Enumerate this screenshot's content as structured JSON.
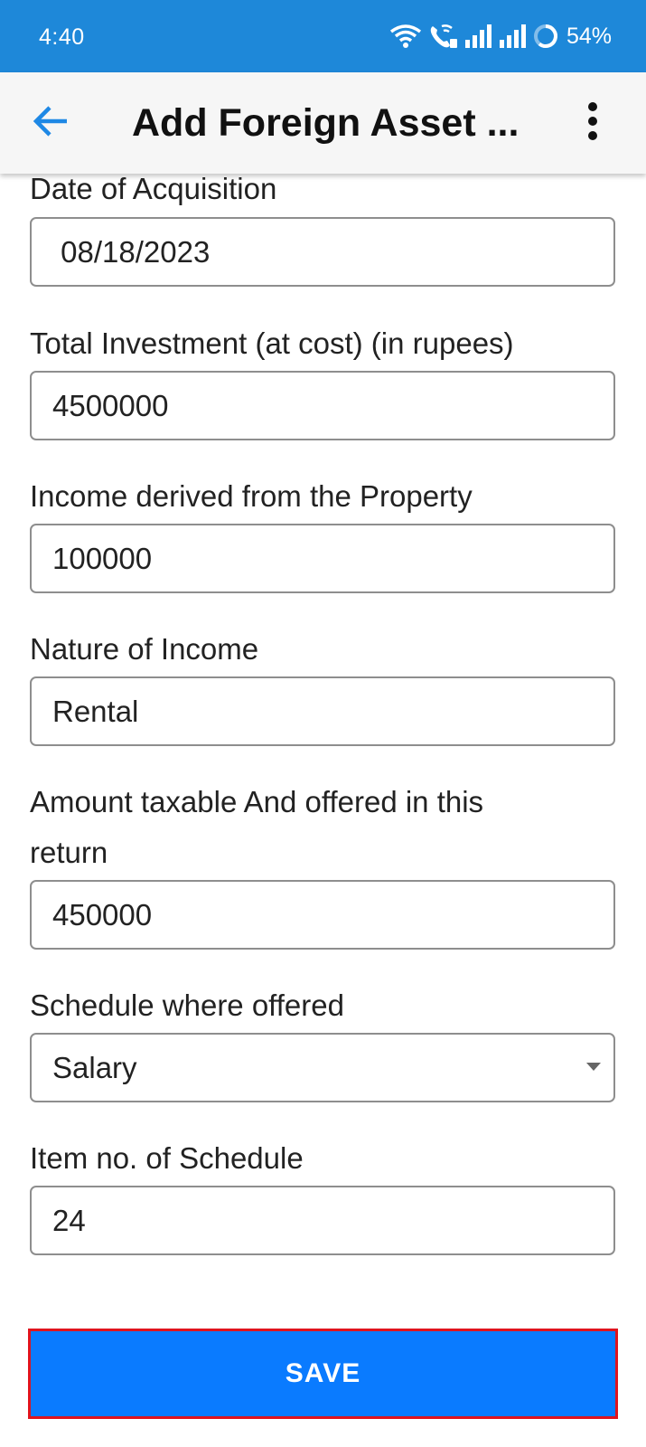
{
  "status_bar": {
    "time": "4:40",
    "battery": "54%",
    "icons": [
      "wifi-icon",
      "wifi-call-icon",
      "signal-icon",
      "signal-icon",
      "battery-icon"
    ]
  },
  "app_bar": {
    "title": "Add Foreign Asset ...",
    "back_icon": "arrow-left-icon",
    "menu_icon": "more-vertical-icon"
  },
  "form": {
    "date_of_acquisition": {
      "label": "Date of Acquisition",
      "value": " 08/18/2023"
    },
    "total_investment": {
      "label": "Total Investment (at cost) (in rupees)",
      "value": "4500000"
    },
    "income_derived": {
      "label": "Income derived from the Property",
      "value": "100000"
    },
    "nature_of_income": {
      "label": "Nature of Income",
      "value": "Rental"
    },
    "amount_taxable": {
      "label_line1": "Amount taxable And offered in this",
      "label_line2": "return",
      "value": "450000"
    },
    "schedule_where_offered": {
      "label": "Schedule where offered",
      "value": "Salary"
    },
    "item_no_of_schedule": {
      "label": "Item no. of Schedule",
      "value": "24"
    }
  },
  "save_button": {
    "label": "SAVE"
  },
  "colors": {
    "status_bar": "#1e88d9",
    "app_bar": "#f6f6f6",
    "accent": "#1e88e5",
    "save_button": "#0a7bff",
    "save_border": "#e0141e"
  }
}
